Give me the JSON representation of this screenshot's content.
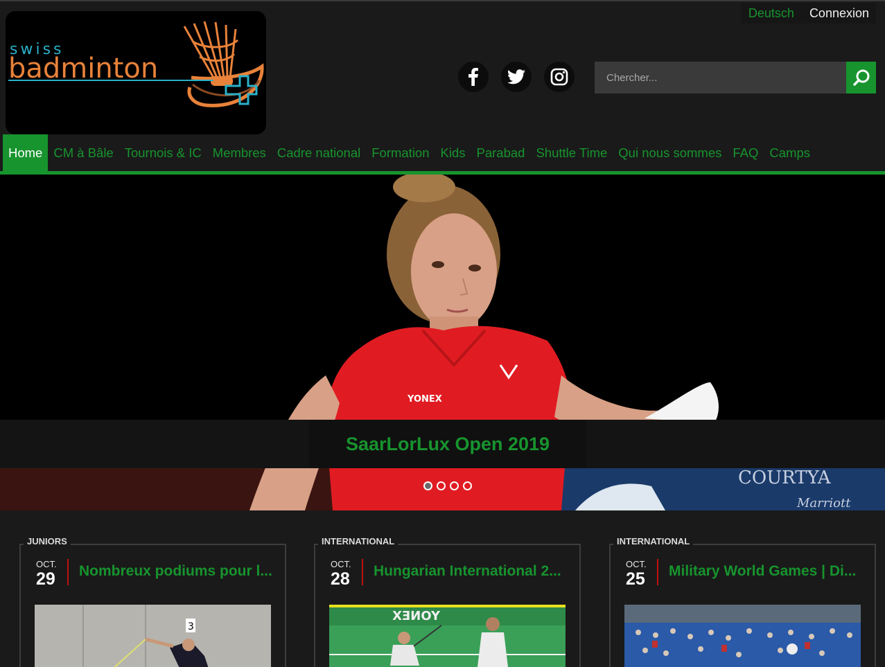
{
  "top_links": {
    "language": "Deutsch",
    "login": "Connexion"
  },
  "logo": {
    "line1": "swiss",
    "line2": "badminton"
  },
  "social": [
    "facebook-icon",
    "twitter-icon",
    "instagram-icon"
  ],
  "search": {
    "placeholder": "Chercher...",
    "value": ""
  },
  "nav": {
    "items": [
      {
        "label": "Home",
        "active": true
      },
      {
        "label": "CM à Bâle"
      },
      {
        "label": "Tournois & IC"
      },
      {
        "label": "Membres"
      },
      {
        "label": "Cadre national"
      },
      {
        "label": "Formation"
      },
      {
        "label": "Kids"
      },
      {
        "label": "Parabad"
      },
      {
        "label": "Shuttle Time"
      },
      {
        "label": "Qui nous sommes"
      },
      {
        "label": "FAQ"
      },
      {
        "label": "Camps"
      }
    ]
  },
  "hero": {
    "caption": "SaarLorLux Open 2019",
    "slide_count": 4,
    "active_slide": 1
  },
  "news": [
    {
      "category": "JUNIORS",
      "month": "OCT.",
      "day": "29",
      "title": "Nombreux podiums pour l..."
    },
    {
      "category": "INTERNATIONAL",
      "month": "OCT.",
      "day": "28",
      "title": "Hungarian International 2..."
    },
    {
      "category": "INTERNATIONAL",
      "month": "OCT.",
      "day": "25",
      "title": "Military World Games | Di..."
    }
  ],
  "colors": {
    "accent": "#17942e",
    "background": "#1a1a1a",
    "date_separator": "#c01010"
  }
}
